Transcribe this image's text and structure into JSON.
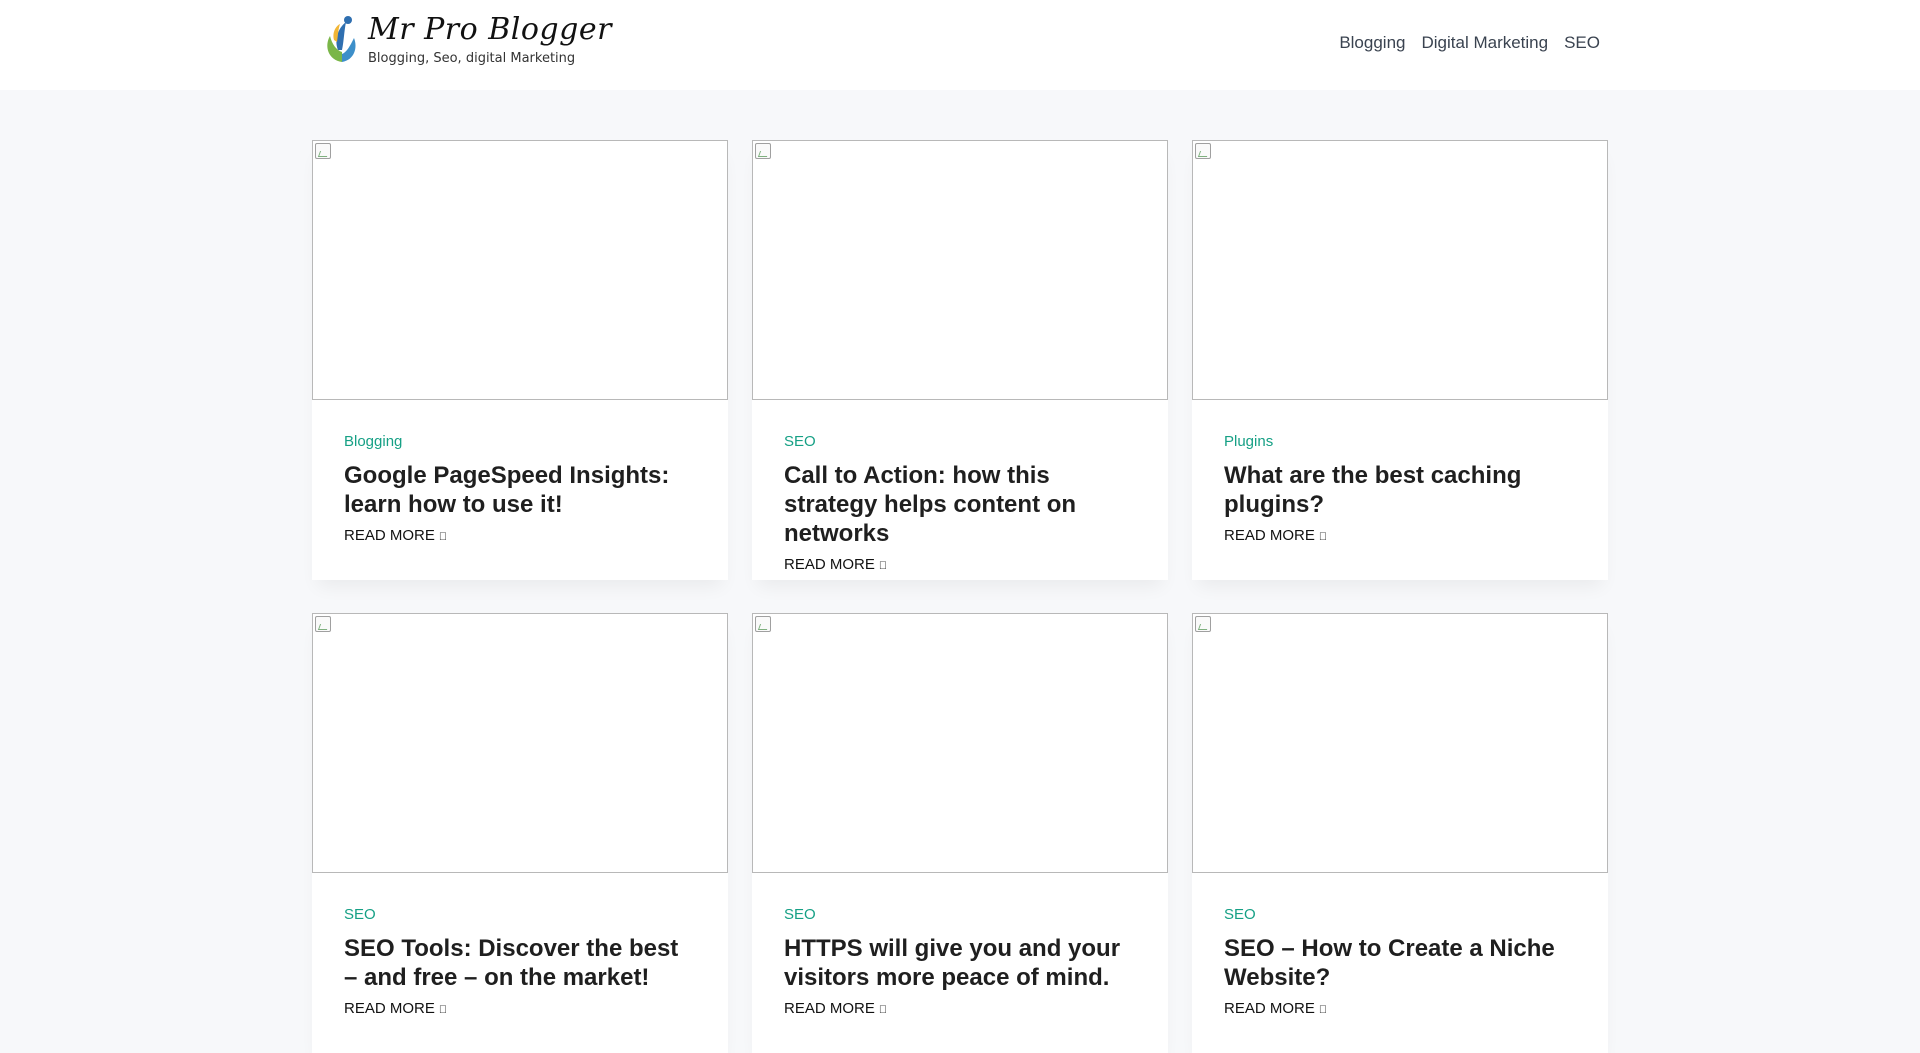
{
  "site": {
    "title": "Mr Pro Blogger",
    "tagline": "Blogging, Seo, digital Marketing",
    "logo_icon": "leaf-figure-logo-icon"
  },
  "nav": {
    "items": [
      {
        "label": "Blogging"
      },
      {
        "label": "Digital Marketing"
      },
      {
        "label": "SEO"
      }
    ]
  },
  "posts": [
    {
      "category": "Blogging",
      "title": "Google PageSpeed Insights: learn how to use it!",
      "read_more": "READ MORE",
      "arrow": ""
    },
    {
      "category": "SEO",
      "title": "Call to Action: how this strategy helps content on networks",
      "read_more": "READ MORE",
      "arrow": ""
    },
    {
      "category": "Plugins",
      "title": "What are the best caching plugins?",
      "read_more": "READ MORE",
      "arrow": ""
    },
    {
      "category": "SEO",
      "title": "SEO Tools: Discover the best – and free – on the market!",
      "read_more": "READ MORE",
      "arrow": ""
    },
    {
      "category": "SEO",
      "title": "HTTPS will give you and your visitors more peace of mind.",
      "read_more": "READ MORE",
      "arrow": ""
    },
    {
      "category": "SEO",
      "title": "SEO – How to Create a Niche Website?",
      "read_more": "READ MORE",
      "arrow": ""
    }
  ],
  "colors": {
    "accent": "#16a085",
    "background": "#f7f8fa",
    "header": "#ffffff"
  }
}
